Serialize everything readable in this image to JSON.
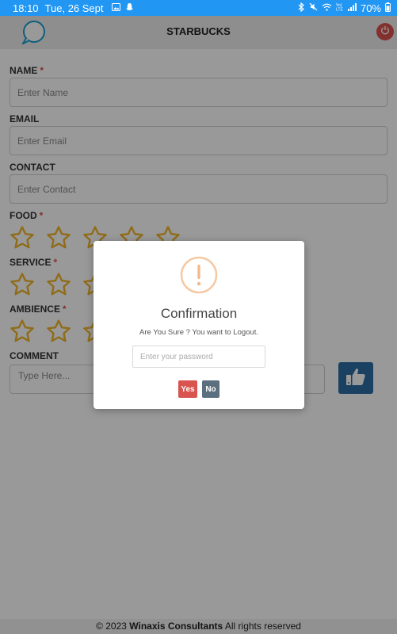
{
  "status_bar": {
    "time": "18:10",
    "date": "Tue, 26 Sept",
    "battery": "70%",
    "color": "#2196f3"
  },
  "header": {
    "title": "STARBUCKS",
    "logo_text": "feedback"
  },
  "form": {
    "name_label": "NAME",
    "name_placeholder": "Enter Name",
    "email_label": "EMAIL",
    "email_placeholder": "Enter Email",
    "contact_label": "CONTACT",
    "contact_placeholder": "Enter Contact",
    "food_label": "FOOD",
    "service_label": "SERVICE",
    "ambience_label": "AMBIENCE",
    "comment_label": "COMMENT",
    "comment_placeholder": "Type Here...",
    "required_mark": "*",
    "star_count": 5,
    "star_color": "#f0b429"
  },
  "footer": {
    "prefix": "© 2023 ",
    "company": "Winaxis Consultants",
    "suffix": " All rights reserved"
  },
  "modal": {
    "icon": "exclamation-circle-icon",
    "title": "Confirmation",
    "message": "Are You Sure ? You want to Logout.",
    "password_placeholder": "Enter your password",
    "yes_label": "Yes",
    "no_label": "No",
    "yes_color": "#d9534f",
    "no_color": "#5c6f7f"
  }
}
